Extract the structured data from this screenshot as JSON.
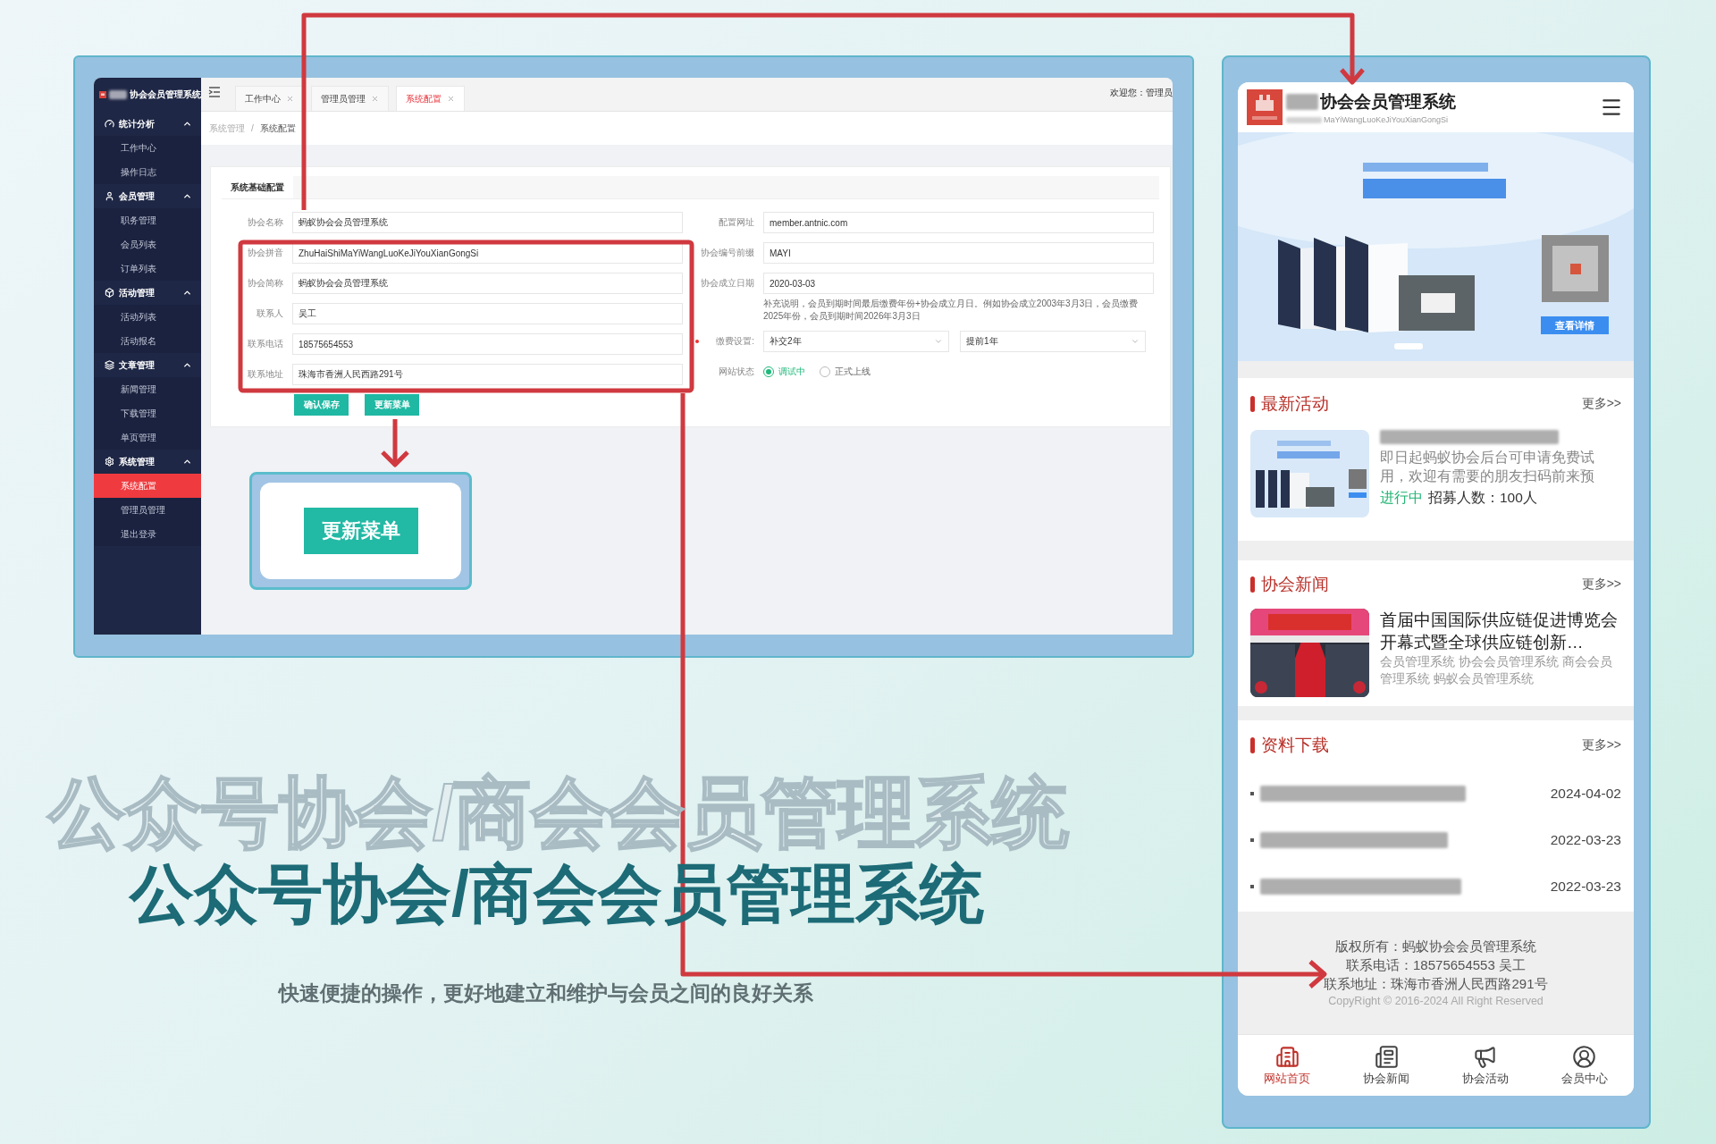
{
  "admin": {
    "brand": "协会会员管理系统",
    "menu": [
      {
        "label": "统计分析",
        "expanded": true,
        "children": [
          {
            "label": "工作中心",
            "selected": false
          },
          {
            "label": "操作日志",
            "selected": false
          }
        ]
      },
      {
        "label": "会员管理",
        "expanded": true,
        "children": [
          {
            "label": "职务管理",
            "selected": false
          },
          {
            "label": "会员列表",
            "selected": false
          },
          {
            "label": "订单列表",
            "selected": false
          }
        ]
      },
      {
        "label": "活动管理",
        "expanded": true,
        "children": [
          {
            "label": "活动列表",
            "selected": false
          },
          {
            "label": "活动报名",
            "selected": false
          }
        ]
      },
      {
        "label": "文章管理",
        "expanded": true,
        "children": [
          {
            "label": "新闻管理",
            "selected": false
          },
          {
            "label": "下载管理",
            "selected": false
          },
          {
            "label": "单页管理",
            "selected": false
          }
        ]
      },
      {
        "label": "系统管理",
        "expanded": true,
        "children": [
          {
            "label": "系统配置",
            "selected": true
          },
          {
            "label": "管理员管理",
            "selected": false
          },
          {
            "label": "退出登录",
            "selected": false
          }
        ]
      }
    ],
    "tabs": [
      {
        "label": "工作中心",
        "selected": false
      },
      {
        "label": "管理员管理",
        "selected": false
      },
      {
        "label": "系统配置",
        "selected": true
      }
    ],
    "welcome": "欢迎您：管理员",
    "breadcrumb": [
      "系统管理",
      "系统配置"
    ],
    "breadcrumb_separator": "/",
    "form_tab": "系统基础配置",
    "left_fields": [
      {
        "label": "协会名称",
        "value": "蚂蚁协会会员管理系统"
      },
      {
        "label": "协会拼音",
        "value": "ZhuHaiShiMaYiWangLuoKeJiYouXianGongSi"
      },
      {
        "label": "协会简称",
        "value": "蚂蚁协会会员管理系统"
      },
      {
        "label": "联系人",
        "value": "吴工"
      },
      {
        "label": "联系电话",
        "value": "18575654553"
      },
      {
        "label": "联系地址",
        "value": "珠海市香洲人民西路291号"
      }
    ],
    "right_fields": [
      {
        "kind": "text",
        "label": "配置网址",
        "value": "member.antnic.com"
      },
      {
        "kind": "text",
        "label": "协会编号前缀",
        "value": "MAYI"
      },
      {
        "kind": "text",
        "label": "协会成立日期",
        "value": "2020-03-03",
        "note": "补充说明，会员到期时间最后缴费年份+协会成立月日。例如协会成立2003年3月3日，会员缴费2025年份，会员到期时间2026年3月3日"
      },
      {
        "kind": "selects",
        "label": "缴费设置:",
        "required": true,
        "values": [
          "补交2年",
          "提前1年"
        ]
      },
      {
        "kind": "radios",
        "label": "网站状态",
        "options": [
          {
            "label": "调试中",
            "selected": true
          },
          {
            "label": "正式上线",
            "selected": false
          }
        ]
      }
    ],
    "buttons": [
      "确认保存",
      "更新菜单"
    ]
  },
  "callout": {
    "button": "更新菜单"
  },
  "headline": {
    "outline": "公众号协会/商会会员管理系统",
    "title": "公众号协会/商会会员管理系统",
    "subtitle": "快速便捷的操作，更好地建立和维护与会员之间的良好关系"
  },
  "phone": {
    "title": "协会会员管理系统",
    "subtitle": "MaYiWangLuoKeJiYouXianGongSi",
    "banner_button": "查看详情",
    "sections": [
      {
        "kind": "activity",
        "title": "最新活动",
        "more": "更多>>",
        "desc": "即日起蚂蚁协会后台可申请免费试用，欢迎有需要的朋友扫码前来预",
        "status": "进行中",
        "quota": "招募人数：100人"
      },
      {
        "kind": "news",
        "title": "协会新闻",
        "more": "更多>>",
        "headline": "首届中国国际供应链促进博览会开幕式暨全球供应链创新…",
        "tags": "会员管理系统 协会会员管理系统 商会会员管理系统 蚂蚁会员管理系统"
      },
      {
        "kind": "downloads",
        "title": "资料下载",
        "more": "更多>>",
        "dates": [
          "2024-04-02",
          "2022-03-23",
          "2022-03-23"
        ]
      }
    ],
    "footer": [
      "版权所有：蚂蚁协会会员管理系统",
      "联系电话：18575654553 吴工",
      "联系地址：珠海市香洲人民西路291号"
    ],
    "copyright": "CopyRight © 2016-2024 All Right Reserved",
    "tabs": [
      {
        "label": "网站首页",
        "selected": true
      },
      {
        "label": "协会新闻",
        "selected": false
      },
      {
        "label": "协会活动",
        "selected": false
      },
      {
        "label": "会员中心",
        "selected": false
      }
    ]
  }
}
